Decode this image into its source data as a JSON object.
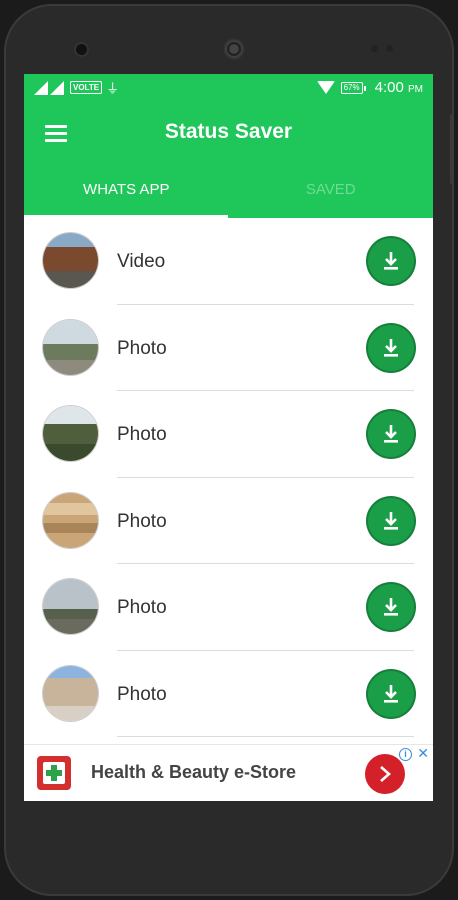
{
  "status_bar": {
    "network": "VOLTE",
    "battery": "67%",
    "time": "4:00",
    "ampm": "PM"
  },
  "toolbar": {
    "title": "Status Saver",
    "menu_icon": "hamburger-menu-icon"
  },
  "tabs": [
    {
      "label": "WHATS APP",
      "active": true
    },
    {
      "label": "SAVED",
      "active": false
    }
  ],
  "items": [
    {
      "label": "Video"
    },
    {
      "label": "Photo"
    },
    {
      "label": "Photo"
    },
    {
      "label": "Photo"
    },
    {
      "label": "Photo"
    },
    {
      "label": "Photo"
    }
  ],
  "ad": {
    "text": "Health & Beauty e-Store",
    "info_icon": "i"
  },
  "colors": {
    "primary": "#1fc65a",
    "download_button": "#1a9e48",
    "ad_button": "#d32029"
  }
}
